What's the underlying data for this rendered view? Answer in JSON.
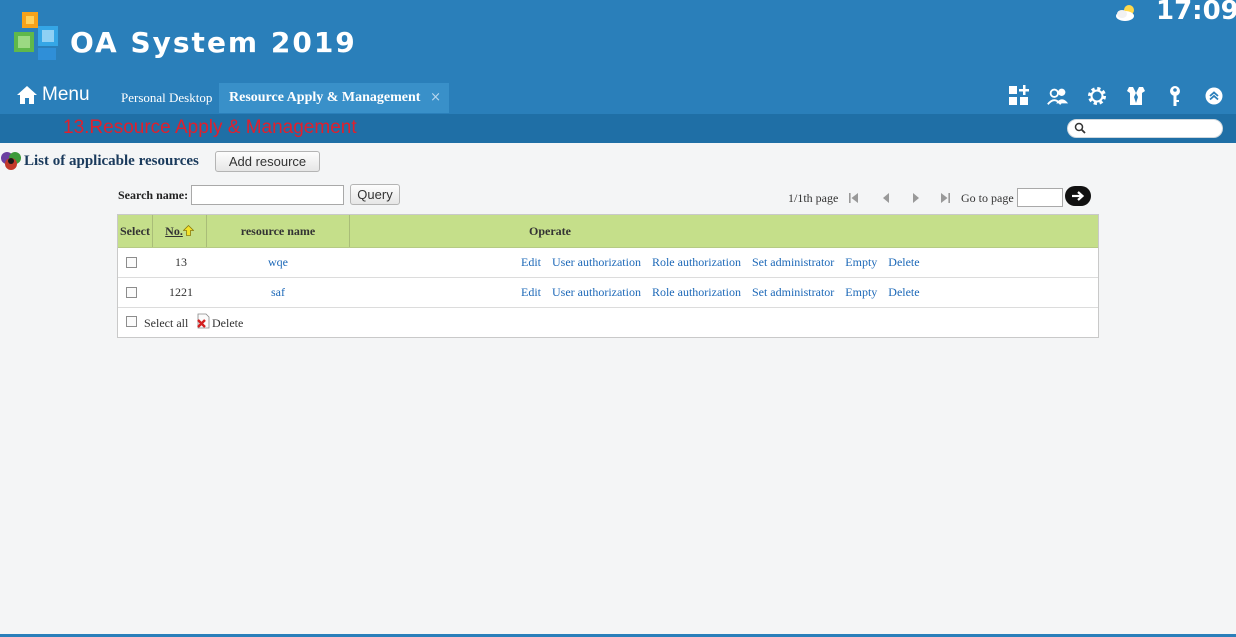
{
  "header": {
    "app_title": "OA System 2019",
    "clock": "17:09",
    "menu_label": "Menu",
    "icons": [
      "home-icon",
      "weather-icon",
      "add-app-icon",
      "users-icon",
      "gear-icon",
      "uniform-icon",
      "key-icon",
      "collapse-up-icon"
    ]
  },
  "tabs": [
    {
      "label": "Personal Desktop",
      "active": false
    },
    {
      "label": "Resource Apply & Management",
      "active": true,
      "close": "×"
    }
  ],
  "breadcrumb": "13.Resource Apply & Management",
  "list": {
    "title": "List of applicable resources",
    "add_button": "Add resource",
    "search_label": "Search name:",
    "search_value": "",
    "query_button": "Query"
  },
  "pager": {
    "status": "1/1th page",
    "goto_label": "Go to page",
    "goto_value": ""
  },
  "table": {
    "headers": {
      "select": "Select",
      "no": "No.",
      "name": "resource name",
      "operate": "Operate"
    },
    "rows": [
      {
        "no": "13",
        "name": "wqe",
        "checked": false
      },
      {
        "no": "1221",
        "name": "saf",
        "checked": false
      }
    ],
    "operations": [
      "Edit",
      "User authorization",
      "Role authorization",
      "Set administrator",
      "Empty",
      "Delete"
    ],
    "footer": {
      "select_all": "Select all",
      "delete": "Delete"
    }
  },
  "colors": {
    "header_bg": "#2a7fba",
    "subbar_bg": "#1f6fa6",
    "breadcrumb": "#e0202d",
    "table_header": "#c5df8a",
    "link": "#1c68b8"
  }
}
